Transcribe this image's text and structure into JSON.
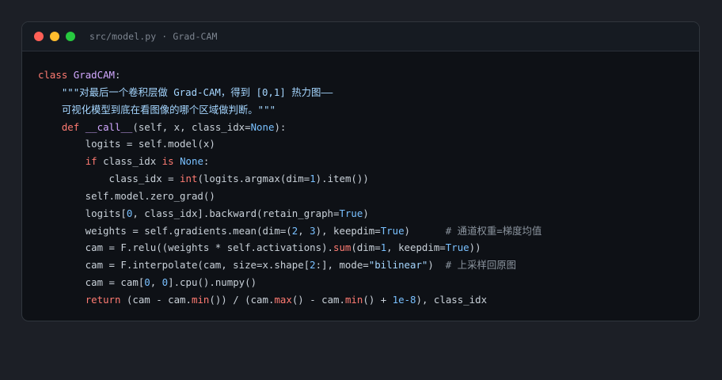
{
  "window": {
    "title": "src/model.py · Grad-CAM"
  },
  "code": {
    "l1": [
      {
        "t": "class",
        "c": "kw"
      },
      {
        "t": " "
      },
      {
        "t": "GradCAM",
        "c": "cls"
      },
      {
        "t": ":"
      }
    ],
    "l2": [
      {
        "t": "    "
      },
      {
        "t": "\"\"\"对最后一个卷积层做 Grad-CAM，得到 [0,1] 热力图——",
        "c": "doc"
      }
    ],
    "l3": [
      {
        "t": "    "
      },
      {
        "t": "可视化模型到底在看图像的哪个区域做判断。\"\"\"",
        "c": "doc"
      }
    ],
    "l4": [
      {
        "t": "    "
      },
      {
        "t": "def",
        "c": "kw"
      },
      {
        "t": " "
      },
      {
        "t": "__call__",
        "c": "fn"
      },
      {
        "t": "(self, x, class_idx="
      },
      {
        "t": "None",
        "c": "const"
      },
      {
        "t": "):"
      }
    ],
    "l5": [
      {
        "t": "        logits = self.model(x)"
      }
    ],
    "l6": [
      {
        "t": "        "
      },
      {
        "t": "if",
        "c": "kw"
      },
      {
        "t": " class_idx "
      },
      {
        "t": "is",
        "c": "kw"
      },
      {
        "t": " "
      },
      {
        "t": "None",
        "c": "const"
      },
      {
        "t": ":"
      }
    ],
    "l7": [
      {
        "t": "            class_idx = "
      },
      {
        "t": "int",
        "c": "kw"
      },
      {
        "t": "(logits.argmax(dim="
      },
      {
        "t": "1",
        "c": "num"
      },
      {
        "t": ").item())"
      }
    ],
    "l8": [
      {
        "t": "        self.model.zero_grad()"
      }
    ],
    "l9": [
      {
        "t": "        logits["
      },
      {
        "t": "0",
        "c": "num"
      },
      {
        "t": ", class_idx].backward(retain_graph="
      },
      {
        "t": "True",
        "c": "const"
      },
      {
        "t": ")"
      }
    ],
    "l10": [
      {
        "t": "        weights = self.gradients.mean(dim=("
      },
      {
        "t": "2",
        "c": "num"
      },
      {
        "t": ", "
      },
      {
        "t": "3",
        "c": "num"
      },
      {
        "t": "), keepdim="
      },
      {
        "t": "True",
        "c": "const"
      },
      {
        "t": ")      "
      },
      {
        "t": "# 通道权重=梯度均值",
        "c": "cmt"
      }
    ],
    "l11": [
      {
        "t": "        cam = F.relu((weights * self.activations)."
      },
      {
        "t": "sum",
        "c": "kw"
      },
      {
        "t": "(dim="
      },
      {
        "t": "1",
        "c": "num"
      },
      {
        "t": ", keepdim="
      },
      {
        "t": "True",
        "c": "const"
      },
      {
        "t": "))"
      }
    ],
    "l12": [
      {
        "t": "        cam = F.interpolate(cam, size=x.shape["
      },
      {
        "t": "2",
        "c": "num"
      },
      {
        "t": ":], mode="
      },
      {
        "t": "\"bilinear\"",
        "c": "str"
      },
      {
        "t": ")  "
      },
      {
        "t": "# 上采样回原图",
        "c": "cmt"
      }
    ],
    "l13": [
      {
        "t": "        cam = cam["
      },
      {
        "t": "0",
        "c": "num"
      },
      {
        "t": ", "
      },
      {
        "t": "0",
        "c": "num"
      },
      {
        "t": "].cpu().numpy()"
      }
    ],
    "l14": [
      {
        "t": "        "
      },
      {
        "t": "return",
        "c": "kw"
      },
      {
        "t": " (cam - cam."
      },
      {
        "t": "min",
        "c": "kw"
      },
      {
        "t": "()) / (cam."
      },
      {
        "t": "max",
        "c": "kw"
      },
      {
        "t": "() - cam."
      },
      {
        "t": "min",
        "c": "kw"
      },
      {
        "t": "() + "
      },
      {
        "t": "1e-8",
        "c": "num"
      },
      {
        "t": "), class_idx"
      }
    ]
  }
}
